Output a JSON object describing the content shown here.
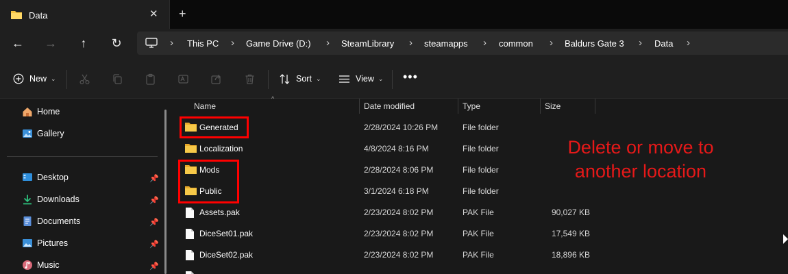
{
  "window": {
    "tab_title": "Data",
    "close_glyph": "✕",
    "new_tab_glyph": "+"
  },
  "nav": {
    "back": "←",
    "forward": "→",
    "up": "↑",
    "refresh": "↻"
  },
  "breadcrumbs": [
    "This PC",
    "Game Drive (D:)",
    "SteamLibrary",
    "steamapps",
    "common",
    "Baldurs Gate 3",
    "Data"
  ],
  "breadcrumb_sep": "›",
  "toolbar": {
    "new_label": "New",
    "sort_label": "Sort",
    "view_label": "View",
    "more_label": "•••",
    "chevron": "⌄"
  },
  "sidebar": {
    "top_items": [
      {
        "label": "Home",
        "icon": "home-icon"
      },
      {
        "label": "Gallery",
        "icon": "gallery-icon"
      }
    ],
    "quick_items": [
      {
        "label": "Desktop",
        "icon": "desktop-icon"
      },
      {
        "label": "Downloads",
        "icon": "download-icon"
      },
      {
        "label": "Documents",
        "icon": "documents-icon"
      },
      {
        "label": "Pictures",
        "icon": "pictures-icon"
      },
      {
        "label": "Music",
        "icon": "music-icon"
      }
    ],
    "pin_glyph": "📌"
  },
  "columns": {
    "name": "Name",
    "date": "Date modified",
    "type": "Type",
    "size": "Size",
    "sort_glyph": "^"
  },
  "files": [
    {
      "name": "Generated",
      "date": "2/28/2024 10:26 PM",
      "type": "File folder",
      "size": "",
      "kind": "folder"
    },
    {
      "name": "Localization",
      "date": "4/8/2024 8:16 PM",
      "type": "File folder",
      "size": "",
      "kind": "folder"
    },
    {
      "name": "Mods",
      "date": "2/28/2024 8:06 PM",
      "type": "File folder",
      "size": "",
      "kind": "folder"
    },
    {
      "name": "Public",
      "date": "3/1/2024 6:18 PM",
      "type": "File folder",
      "size": "",
      "kind": "folder"
    },
    {
      "name": "Assets.pak",
      "date": "2/23/2024 8:02 PM",
      "type": "PAK File",
      "size": "90,027 KB",
      "kind": "file"
    },
    {
      "name": "DiceSet01.pak",
      "date": "2/23/2024 8:02 PM",
      "type": "PAK File",
      "size": "17,549 KB",
      "kind": "file"
    },
    {
      "name": "DiceSet02.pak",
      "date": "2/23/2024 8:02 PM",
      "type": "PAK File",
      "size": "18,896 KB",
      "kind": "file"
    }
  ],
  "annotation": {
    "text": "Delete or move to another location",
    "color": "#e61919"
  },
  "colors": {
    "folder": "#f5c342",
    "accent": "#60cdff",
    "highlight": "#ff0000"
  }
}
